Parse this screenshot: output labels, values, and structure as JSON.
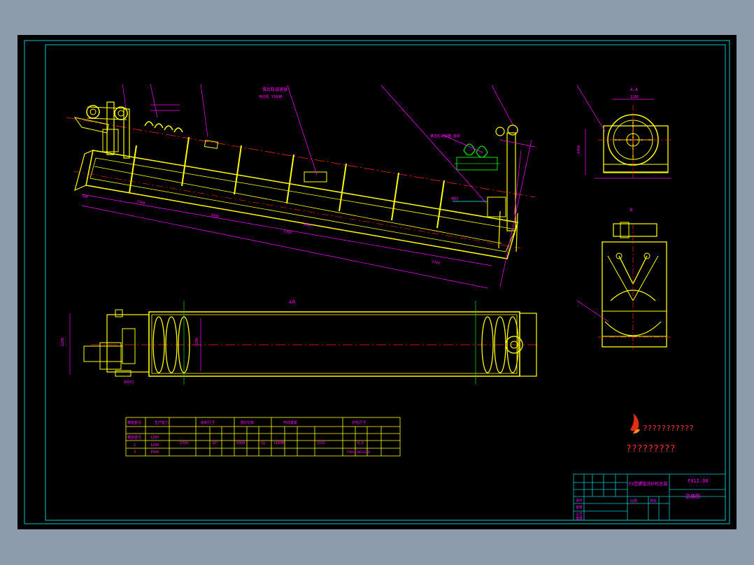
{
  "window": {
    "background": "#8d9cad",
    "sheet_background": "#000000"
  },
  "colors": {
    "frame": "#00c8c8",
    "part": "#ffff00",
    "dim": "#ff00ff",
    "center": "#ff2020",
    "cyan": "#00ffff",
    "green": "#00e000",
    "white": "#ffffff",
    "logo": "#e03010"
  },
  "labels": {
    "top_view": "A向",
    "section": "A-A",
    "view_b": "B",
    "dim_overall_1": "7700",
    "dim_overall_2": "7390",
    "dim_mid": "3000",
    "dim_height": "1460",
    "dim_width": "1280",
    "dim_small": "1200"
  },
  "spec_table": {
    "headers": [
      "螺旋直径",
      "生产能力",
      "给料尺寸",
      "洗砂功率",
      "传动装置",
      "外形尺寸"
    ],
    "rows": [
      [
        "螺旋直径",
        "mm",
        "1200",
        "φ",
        "1760",
        "15°",
        "5000",
        "11",
        "Y160M",
        "Y132",
        "8.5",
        "7700×1200×3250"
      ],
      [
        "2",
        "1200",
        "",
        "",
        "",
        "",
        "",
        "",
        "",
        "",
        "",
        ""
      ],
      [
        "3",
        "1500",
        "",
        "",
        "",
        "",
        "",
        "",
        "",
        "",
        "",
        ""
      ]
    ]
  },
  "watermark": {
    "line1": "???????????",
    "line2": "?????????"
  },
  "title_block": {
    "code": "FX12.00",
    "name": "总装图",
    "company": "FX型螺旋洗砂机总装",
    "row_labels": [
      "设计",
      "审核",
      "工艺",
      "批准"
    ],
    "scale_label": "比例",
    "sheet_label": "共张"
  }
}
